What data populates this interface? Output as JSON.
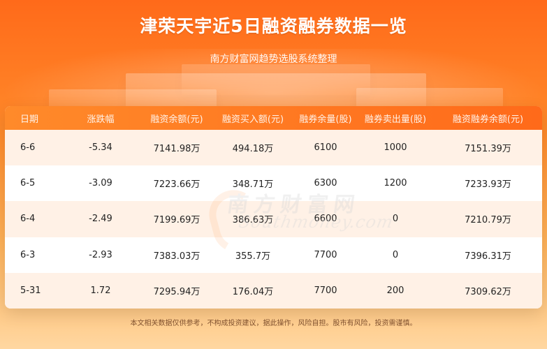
{
  "page": {
    "title": "津荣天宇近5日融资融券数据一览",
    "subtitle": "南方财富网趋势选股系统整理",
    "watermark": {
      "cn": "南方财富网",
      "en": "Southmoney.com"
    },
    "footer": "本文相关数据仅供参考，不构成投资建议，据此操作，风险自担。股市有风险，投资需谨慎。"
  },
  "table": {
    "headers": [
      "日期",
      "涨跌幅",
      "融资余额(元)",
      "融资买入额(元)",
      "融券余量(股)",
      "融券卖出量(股)",
      "融资融券余额(元)"
    ],
    "rows": [
      [
        "6-6",
        "-5.34",
        "7141.98万",
        "494.18万",
        "6100",
        "1000",
        "7151.39万"
      ],
      [
        "6-5",
        "-3.09",
        "7223.66万",
        "348.71万",
        "6300",
        "1200",
        "7233.93万"
      ],
      [
        "6-4",
        "-2.49",
        "7199.69万",
        "386.63万",
        "6600",
        "0",
        "7210.79万"
      ],
      [
        "6-3",
        "-2.93",
        "7383.03万",
        "355.7万",
        "7700",
        "0",
        "7396.31万"
      ],
      [
        "5-31",
        "1.72",
        "7295.94万",
        "176.04万",
        "7700",
        "200",
        "7309.62万"
      ]
    ]
  },
  "colors": {
    "accent_orange": "#ff6a1a",
    "row_alt": "#fff1e6",
    "text_dark": "#222222"
  }
}
